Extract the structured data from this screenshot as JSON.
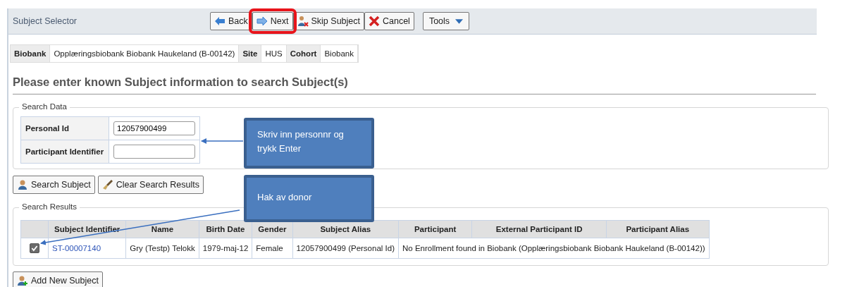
{
  "header": {
    "title": "Subject Selector",
    "buttons": [
      {
        "label": "Back",
        "highlighted": false
      },
      {
        "label": "Next",
        "highlighted": true
      },
      {
        "label": "Skip Subject",
        "highlighted": false
      },
      {
        "label": "Cancel",
        "highlighted": false
      }
    ],
    "menu": {
      "label": "Tools"
    }
  },
  "context": [
    {
      "label": "Biobank",
      "value": "Opplæringsbiobank Biobank Haukeland (B-00142)"
    },
    {
      "label": "Site",
      "value": "HUS"
    },
    {
      "label": "Cohort",
      "value": "Biobank"
    }
  ],
  "heading": "Please enter known Subject information to search Subject(s)",
  "search_data": {
    "legend": "Search Data",
    "fields": [
      {
        "label": "Personal Id",
        "value": "12057900499"
      },
      {
        "label": "Participant Identifier"
      }
    ]
  },
  "actions": [
    {
      "label": "Search Subject"
    },
    {
      "label": "Clear Search Results"
    }
  ],
  "search_results": {
    "legend": "Search Results",
    "columns": [
      "Subject Identifier",
      "Name",
      "Birth Date",
      "Gender",
      "Subject Alias",
      "Participant",
      "External Participant ID",
      "Participant Alias"
    ],
    "rows": [
      {
        "checked": true,
        "cells": [
          "ST-00007140",
          "Gry (Testp) Telokk",
          "1979-maj-12",
          "Female",
          "12057900499 (Personal Id)",
          {
            "text": "No Enrollment found in Biobank (Opplæringsbiobank Biobank Haukeland (B-00142))",
            "colspan": 3
          }
        ]
      }
    ]
  },
  "footer_button": {
    "label": "Add New Subject"
  },
  "callouts": [
    {
      "text": "Skriv inn personnr og trykk Enter"
    },
    {
      "text": "Hak av donor"
    }
  ]
}
